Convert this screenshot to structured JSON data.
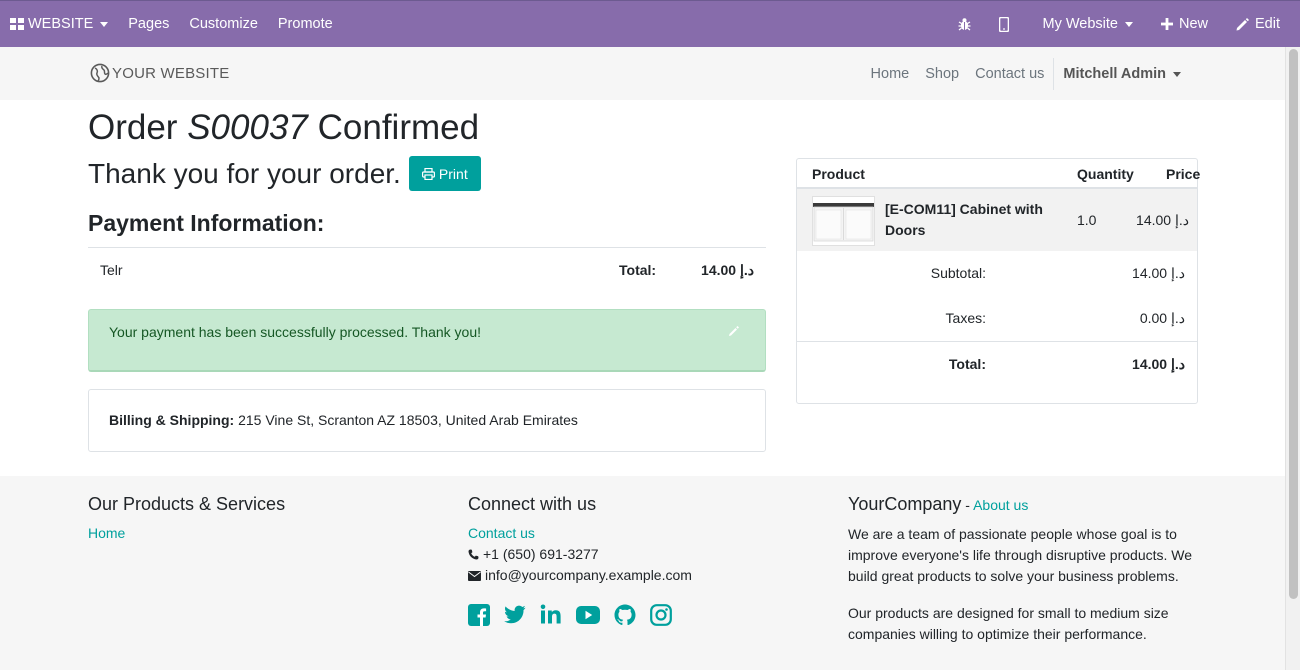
{
  "adminbar": {
    "brand": "WEBSITE",
    "menu": [
      "Pages",
      "Customize",
      "Promote"
    ],
    "website_switcher": "My Website",
    "new_label": "New",
    "edit_label": "Edit"
  },
  "header": {
    "logo_text": "YOUR WEBSITE",
    "nav": [
      "Home",
      "Shop",
      "Contact us"
    ],
    "user": "Mitchell Admin"
  },
  "order": {
    "title_prefix": "Order",
    "order_ref": "S00037",
    "title_suffix": "Confirmed",
    "thanks": "Thank you for your order.",
    "print_label": "Print",
    "payment_heading": "Payment Information:",
    "payment_method": "Telr",
    "total_label": "Total:",
    "total_value": "14.00 د.إ",
    "success_message": "Your payment has been successfully processed. Thank you!",
    "billing_label": "Billing & Shipping:",
    "billing_address": " 215 Vine St, Scranton AZ 18503, United Arab Emirates"
  },
  "summary": {
    "headers": {
      "product": "Product",
      "quantity": "Quantity",
      "price": "Price"
    },
    "line": {
      "name": "[E-COM11] Cabinet with Doors",
      "quantity": "1.0",
      "price": "14.00 د.إ"
    },
    "subtotal_label": "Subtotal:",
    "subtotal_value": "14.00 د.إ",
    "taxes_label": "Taxes:",
    "taxes_value": "0.00 د.إ",
    "total_label": "Total:",
    "total_value": "14.00 د.إ"
  },
  "footer": {
    "col1_title": "Our Products & Services",
    "col1_link": "Home",
    "col2_title": "Connect with us",
    "contact_link": "Contact us",
    "phone": "+1 (650) 691-3277",
    "email": "info@yourcompany.example.com",
    "social": [
      "facebook-icon",
      "twitter-icon",
      "linkedin-icon",
      "youtube-icon",
      "github-icon",
      "instagram-icon"
    ],
    "col3_company": "YourCompany",
    "col3_sep": " - ",
    "col3_link": "About us",
    "about_p1": "We are a team of passionate people whose goal is to improve everyone's life through disruptive products. We build great products to solve your business problems.",
    "about_p2": "Our products are designed for small to medium size companies willing to optimize their performance."
  },
  "colors": {
    "adminbar": "#876cab",
    "accent": "#00a09d",
    "success_bg": "#c6e9d1",
    "success_text": "#155724"
  }
}
